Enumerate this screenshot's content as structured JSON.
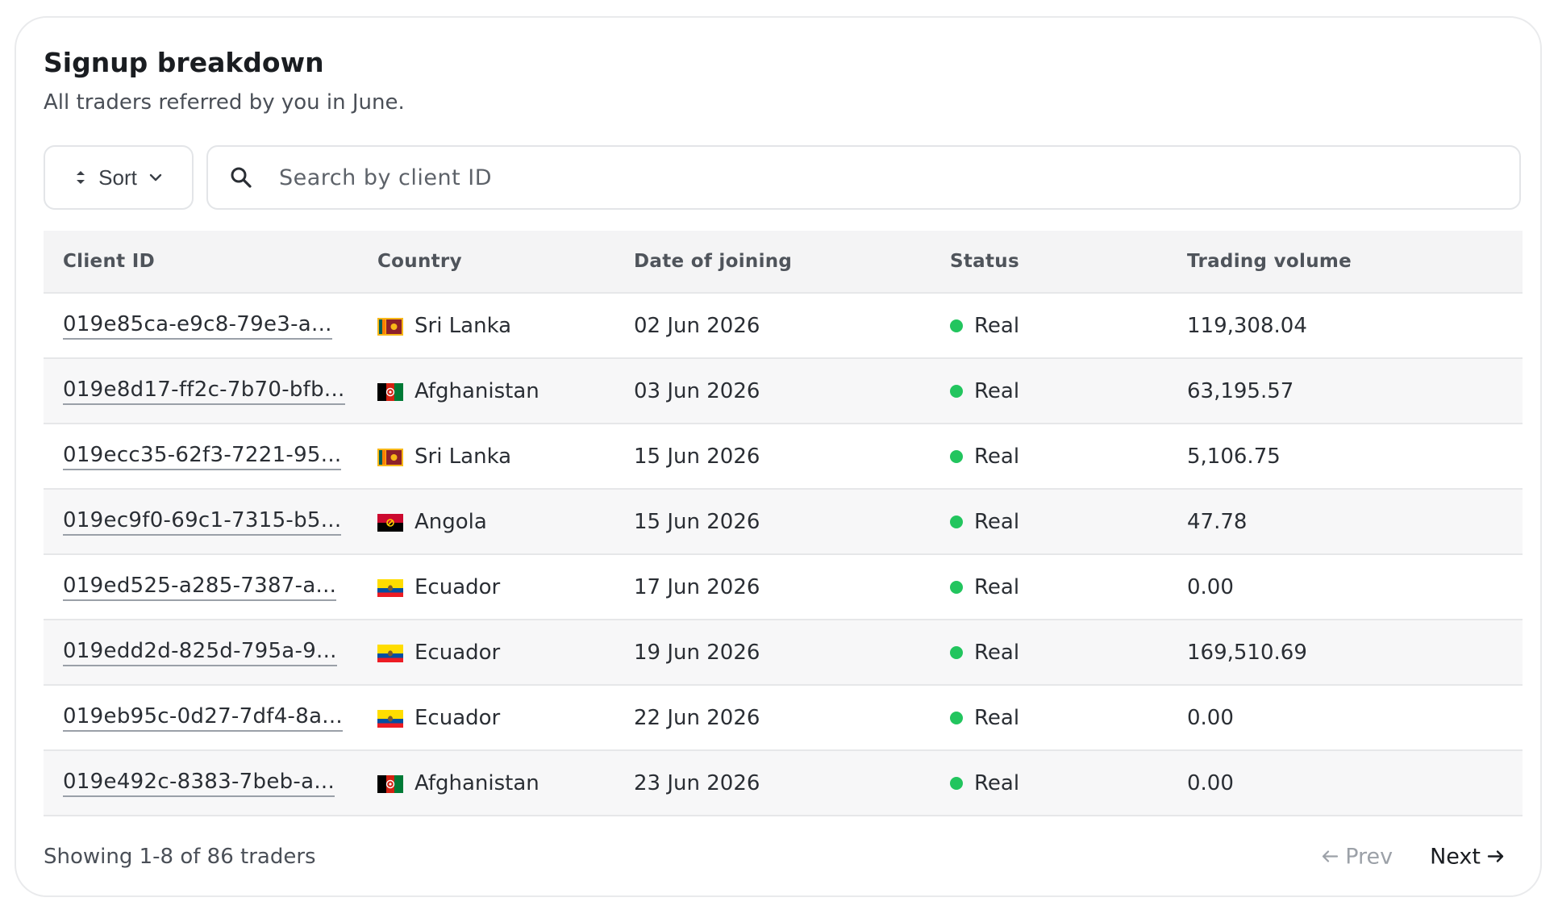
{
  "header": {
    "title": "Signup breakdown",
    "subtitle": "All traders referred by you in June."
  },
  "toolbar": {
    "sort_label": "Sort",
    "search_placeholder": "Search by client ID"
  },
  "table": {
    "columns": [
      "Client ID",
      "Country",
      "Date of joining",
      "Status",
      "Trading volume"
    ],
    "rows": [
      {
        "client_id": "019e85ca-e9c8-79e3-a...",
        "country": "Sri Lanka",
        "flag": "sri-lanka",
        "date": "02 Jun 2026",
        "status": "Real",
        "volume": "119,308.04"
      },
      {
        "client_id": "019e8d17-ff2c-7b70-bfb...",
        "country": "Afghanistan",
        "flag": "afghanistan",
        "date": "03 Jun 2026",
        "status": "Real",
        "volume": "63,195.57"
      },
      {
        "client_id": "019ecc35-62f3-7221-95...",
        "country": "Sri Lanka",
        "flag": "sri-lanka",
        "date": "15 Jun 2026",
        "status": "Real",
        "volume": "5,106.75"
      },
      {
        "client_id": "019ec9f0-69c1-7315-b5...",
        "country": "Angola",
        "flag": "angola",
        "date": "15 Jun 2026",
        "status": "Real",
        "volume": "47.78"
      },
      {
        "client_id": "019ed525-a285-7387-a...",
        "country": "Ecuador",
        "flag": "ecuador",
        "date": "17 Jun 2026",
        "status": "Real",
        "volume": "0.00"
      },
      {
        "client_id": "019edd2d-825d-795a-9...",
        "country": "Ecuador",
        "flag": "ecuador",
        "date": "19 Jun 2026",
        "status": "Real",
        "volume": "169,510.69"
      },
      {
        "client_id": "019eb95c-0d27-7df4-8a...",
        "country": "Ecuador",
        "flag": "ecuador",
        "date": "22 Jun 2026",
        "status": "Real",
        "volume": "0.00"
      },
      {
        "client_id": "019e492c-8383-7beb-a...",
        "country": "Afghanistan",
        "flag": "afghanistan",
        "date": "23 Jun 2026",
        "status": "Real",
        "volume": "0.00"
      }
    ]
  },
  "footer": {
    "showing": "Showing 1-8 of 86 traders",
    "prev_label": "Prev",
    "next_label": "Next"
  },
  "colors": {
    "status_real": "#22c55e",
    "header_bg": "#f4f4f5",
    "border": "#e6e7e9"
  }
}
